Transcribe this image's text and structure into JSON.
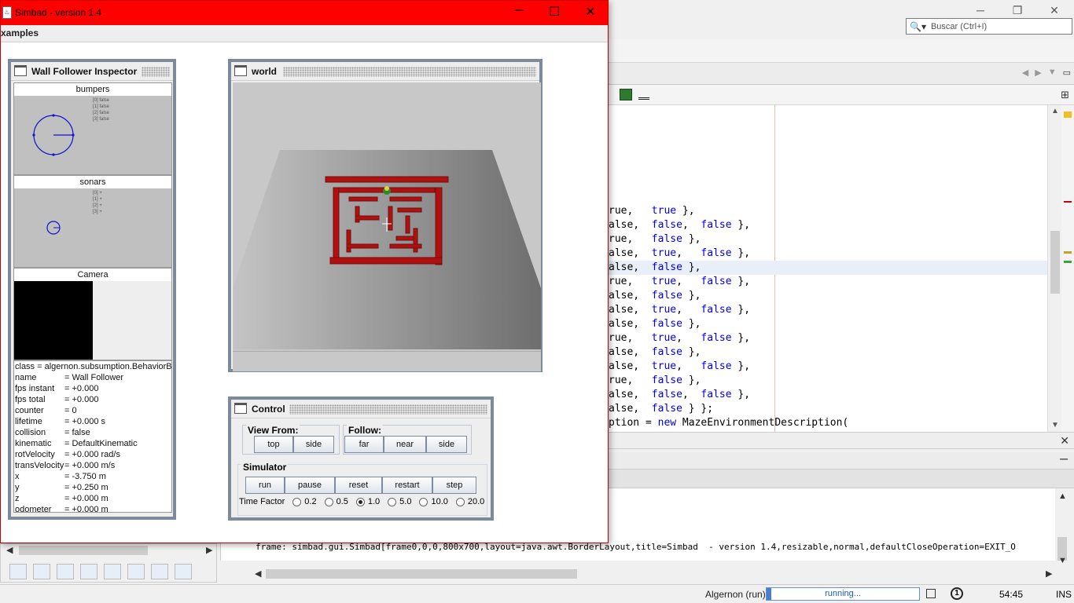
{
  "ide": {
    "search_placeholder": "Buscar (Ctrl+I)",
    "code_lines": [
      {
        "pre": "rue,   ",
        "a": "true",
        "post": " },",
        "b": "",
        "c": ""
      },
      {
        "pre": "alse,  ",
        "a": "false",
        "post": ",  ",
        "b": "false",
        "c": " },"
      },
      {
        "pre": "rue,   ",
        "a": "false",
        "post": " },",
        "b": "",
        "c": ""
      },
      {
        "pre": "alse,  ",
        "a": "true",
        "post": ",   ",
        "b": "false",
        "c": " },"
      },
      {
        "pre": "alse,  ",
        "a": "false",
        "post": " },",
        "b": "",
        "c": ""
      },
      {
        "pre": "rue,   ",
        "a": "true",
        "post": ",   ",
        "b": "false",
        "c": " },"
      },
      {
        "pre": "alse,  ",
        "a": "false",
        "post": " },",
        "b": "",
        "c": ""
      },
      {
        "pre": "alse,  ",
        "a": "true",
        "post": ",   ",
        "b": "false",
        "c": " },"
      },
      {
        "pre": "alse,  ",
        "a": "false",
        "post": " },",
        "b": "",
        "c": ""
      },
      {
        "pre": "rue,   ",
        "a": "true",
        "post": ",   ",
        "b": "false",
        "c": " },"
      },
      {
        "pre": "alse,  ",
        "a": "false",
        "post": " },",
        "b": "",
        "c": ""
      },
      {
        "pre": "alse,  ",
        "a": "true",
        "post": ",   ",
        "b": "false",
        "c": " },"
      },
      {
        "pre": "rue,   ",
        "a": "false",
        "post": " },",
        "b": "",
        "c": ""
      },
      {
        "pre": "alse,  ",
        "a": "false",
        "post": ",  ",
        "b": "false",
        "c": " },"
      },
      {
        "pre": "alse,  ",
        "a": "false",
        "post": " } };",
        "b": "",
        "c": ""
      }
    ],
    "code_last": {
      "pre": "ption = ",
      "kw": "new",
      "post": " MazeEnvironmentDescription("
    },
    "output_line": "frame: simbad.gui.Simbad[frame0,0,0,800x700,layout=java.awt.BorderLayout,title=Simbad  - version 1.4,resizable,normal,defaultCloseOperation=EXIT_O",
    "status": {
      "project": "Algernon (run)",
      "progress": "running...",
      "notifications": "1",
      "time": "54:45",
      "mode": "INS"
    }
  },
  "simbad": {
    "title": "Simbad  - version 1.4",
    "menu": "xamples",
    "inspector": {
      "title": "Wall Follower Inspector",
      "bumpers_label": "bumpers",
      "bumper_values": [
        "[0] false",
        "[1] false",
        "[2] false",
        "[3] false"
      ],
      "sonars_label": "sonars",
      "sonar_values": [
        "[0] +",
        "[1] +",
        "[2] +",
        "[3] +"
      ],
      "camera_label": "Camera",
      "properties": [
        {
          "k": "class = algernon.subsumption.BehaviorBa",
          "v": ""
        },
        {
          "k": "name",
          "v": "= Wall Follower"
        },
        {
          "k": "fps instant",
          "v": "= +0.000"
        },
        {
          "k": "fps total",
          "v": "= +0.000"
        },
        {
          "k": "counter",
          "v": "= 0"
        },
        {
          "k": "lifetime",
          "v": "= +0.000 s"
        },
        {
          "k": "collision",
          "v": "= false"
        },
        {
          "k": "kinematic",
          "v": "= DefaultKinematic"
        },
        {
          "k": "rotVelocity",
          "v": "= +0.000 rad/s"
        },
        {
          "k": "transVelocity",
          "v": "               = +0.000 m/s"
        },
        {
          "k": "x",
          "v": "= -3.750 m"
        },
        {
          "k": "y",
          "v": "= +0.250 m"
        },
        {
          "k": "z",
          "v": "= +0.000 m"
        },
        {
          "k": "odometer",
          "v": "= +0.000 m"
        }
      ]
    },
    "world": {
      "title": "world"
    },
    "control": {
      "title": "Control",
      "view_from_label": "View From:",
      "view_top": "top",
      "view_side": "side",
      "follow_label": "Follow:",
      "follow_far": "far",
      "follow_near": "near",
      "follow_side": "side",
      "simulator_label": "Simulator",
      "run": "run",
      "pause": "pause",
      "reset": "reset",
      "restart": "restart",
      "step": "step",
      "time_factor_label": "Time Factor",
      "time_factors": [
        "0.2",
        "0.5",
        "1.0",
        "5.0",
        "10.0",
        "20.0"
      ],
      "selected_time_factor": "1.0"
    }
  }
}
